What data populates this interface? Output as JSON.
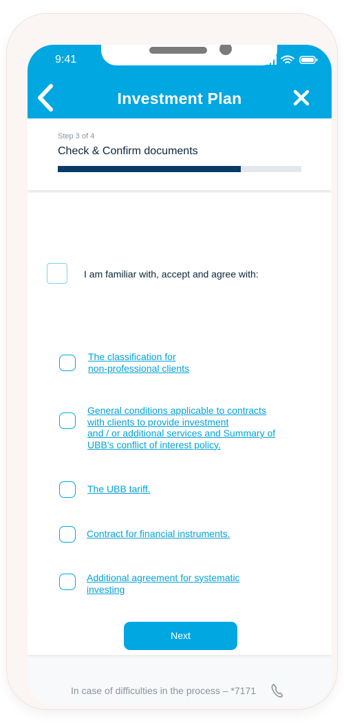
{
  "status_bar": {
    "time": "9:41"
  },
  "header": {
    "title": "Investment Plan"
  },
  "step": {
    "label": "Step 3 of 4",
    "title": "Check & Confirm documents",
    "progress": 0.75
  },
  "agreement": {
    "master_label": "I am familiar with, accept and agree with:",
    "documents": [
      {
        "label": "The classification for\nnon-professional clients"
      },
      {
        "label": "General conditions applicable to contracts\nwith clients to provide investment\nand / or additional services and Summary of\nUBB's conflict of interest policy."
      },
      {
        "label": "The UBB tariff."
      },
      {
        "label": "Contract for financial instruments."
      },
      {
        "label": "Additional agreement for systematic\ninvesting"
      }
    ]
  },
  "actions": {
    "next_label": "Next"
  },
  "support": {
    "text": "In case of difficulties in the process –  *7171"
  },
  "colors": {
    "accent": "#00a7e1",
    "progress": "#0a3a66",
    "link": "#00a2db"
  }
}
